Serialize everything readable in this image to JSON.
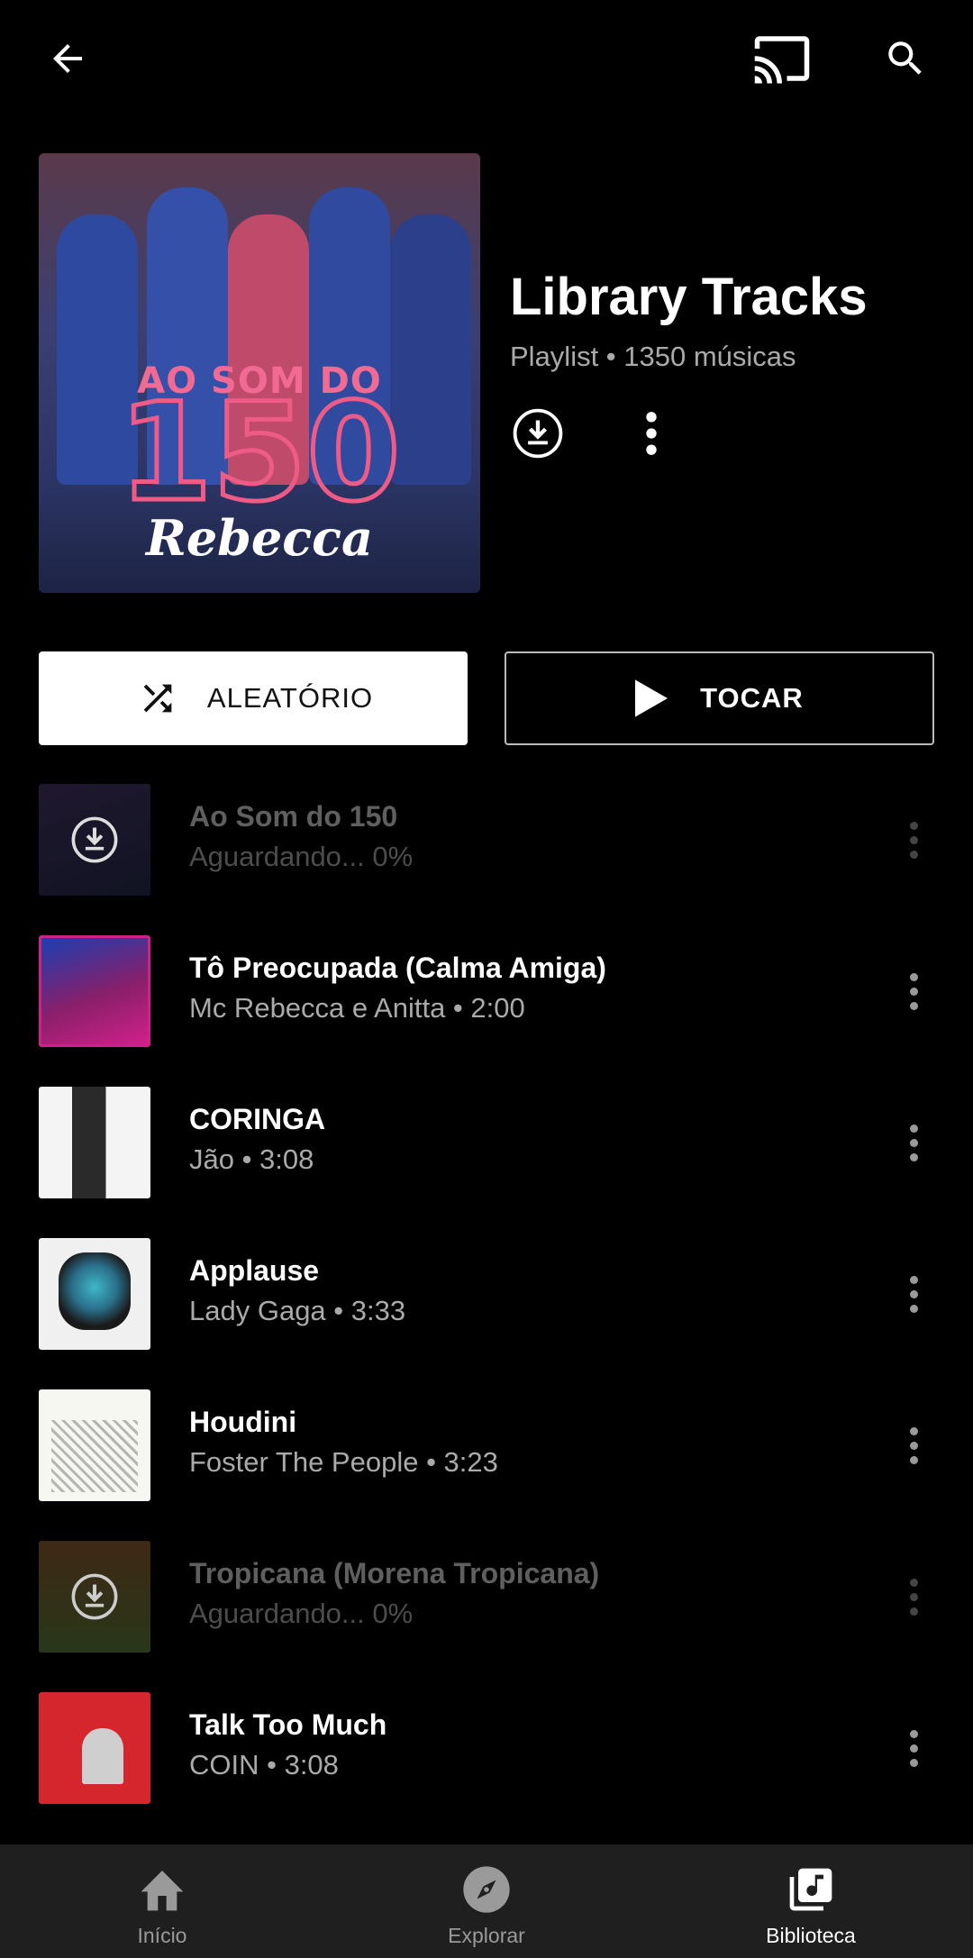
{
  "topbar": {
    "back_icon": "arrow-left-icon",
    "cast_icon": "cast-icon",
    "search_icon": "search-icon"
  },
  "header": {
    "cover_text_line1": "AO SOM DO",
    "cover_text_line2": "150",
    "cover_text_line3": "Rebecca",
    "title": "Library Tracks",
    "subtitle": "Playlist • 1350 músicas",
    "download_icon": "download-circle-icon",
    "more_icon": "more-vert-icon"
  },
  "actions": {
    "shuffle_label": "ALEATÓRIO",
    "play_label": "TOCAR"
  },
  "tracks": [
    {
      "title": "Ao Som do 150",
      "subtitle": "Aguardando... 0%",
      "pending": true,
      "thumb_color": "#2c2a4a"
    },
    {
      "title": "Tô Preocupada (Calma Amiga)",
      "subtitle": "Mc Rebecca e Anitta • 2:00",
      "pending": false,
      "thumb_color": "#6b1f5a"
    },
    {
      "title": "CORINGA",
      "subtitle": "Jão • 3:08",
      "pending": false,
      "thumb_color": "#e8e8e8"
    },
    {
      "title": "Applause",
      "subtitle": "Lady Gaga • 3:33",
      "pending": false,
      "thumb_color": "#f2f2f2"
    },
    {
      "title": "Houdini",
      "subtitle": "Foster The People • 3:23",
      "pending": false,
      "thumb_color": "#f5f5f5"
    },
    {
      "title": "Tropicana (Morena Tropicana)",
      "subtitle": "Aguardando... 0%",
      "pending": true,
      "thumb_color": "#6a4a2a"
    },
    {
      "title": "Talk Too Much",
      "subtitle": "COIN • 3:08",
      "pending": false,
      "thumb_color": "#d4262c"
    }
  ],
  "nav": {
    "items": [
      {
        "label": "Início",
        "icon": "home-icon",
        "active": false
      },
      {
        "label": "Explorar",
        "icon": "compass-icon",
        "active": false
      },
      {
        "label": "Biblioteca",
        "icon": "library-music-icon",
        "active": true
      }
    ]
  },
  "colors": {
    "background": "#000000",
    "nav_background": "#1f1f1f",
    "secondary_text": "#aaaaaa",
    "dim_text": "#5f5f5f",
    "cover_accent": "#ee5b86"
  }
}
